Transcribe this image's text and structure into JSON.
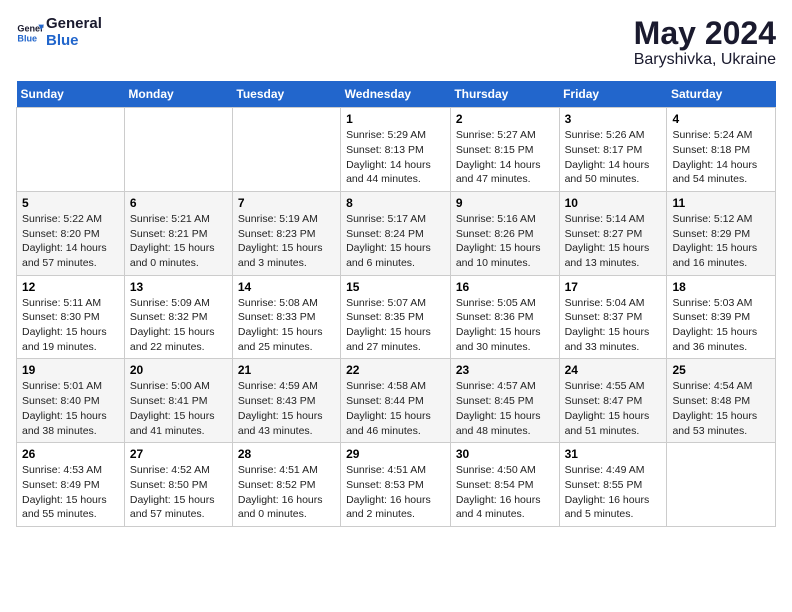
{
  "header": {
    "logo_line1": "General",
    "logo_line2": "Blue",
    "month_year": "May 2024",
    "location": "Baryshivka, Ukraine"
  },
  "days_of_week": [
    "Sunday",
    "Monday",
    "Tuesday",
    "Wednesday",
    "Thursday",
    "Friday",
    "Saturday"
  ],
  "weeks": [
    [
      {
        "day": "",
        "info": ""
      },
      {
        "day": "",
        "info": ""
      },
      {
        "day": "",
        "info": ""
      },
      {
        "day": "1",
        "info": "Sunrise: 5:29 AM\nSunset: 8:13 PM\nDaylight: 14 hours\nand 44 minutes."
      },
      {
        "day": "2",
        "info": "Sunrise: 5:27 AM\nSunset: 8:15 PM\nDaylight: 14 hours\nand 47 minutes."
      },
      {
        "day": "3",
        "info": "Sunrise: 5:26 AM\nSunset: 8:17 PM\nDaylight: 14 hours\nand 50 minutes."
      },
      {
        "day": "4",
        "info": "Sunrise: 5:24 AM\nSunset: 8:18 PM\nDaylight: 14 hours\nand 54 minutes."
      }
    ],
    [
      {
        "day": "5",
        "info": "Sunrise: 5:22 AM\nSunset: 8:20 PM\nDaylight: 14 hours\nand 57 minutes."
      },
      {
        "day": "6",
        "info": "Sunrise: 5:21 AM\nSunset: 8:21 PM\nDaylight: 15 hours\nand 0 minutes."
      },
      {
        "day": "7",
        "info": "Sunrise: 5:19 AM\nSunset: 8:23 PM\nDaylight: 15 hours\nand 3 minutes."
      },
      {
        "day": "8",
        "info": "Sunrise: 5:17 AM\nSunset: 8:24 PM\nDaylight: 15 hours\nand 6 minutes."
      },
      {
        "day": "9",
        "info": "Sunrise: 5:16 AM\nSunset: 8:26 PM\nDaylight: 15 hours\nand 10 minutes."
      },
      {
        "day": "10",
        "info": "Sunrise: 5:14 AM\nSunset: 8:27 PM\nDaylight: 15 hours\nand 13 minutes."
      },
      {
        "day": "11",
        "info": "Sunrise: 5:12 AM\nSunset: 8:29 PM\nDaylight: 15 hours\nand 16 minutes."
      }
    ],
    [
      {
        "day": "12",
        "info": "Sunrise: 5:11 AM\nSunset: 8:30 PM\nDaylight: 15 hours\nand 19 minutes."
      },
      {
        "day": "13",
        "info": "Sunrise: 5:09 AM\nSunset: 8:32 PM\nDaylight: 15 hours\nand 22 minutes."
      },
      {
        "day": "14",
        "info": "Sunrise: 5:08 AM\nSunset: 8:33 PM\nDaylight: 15 hours\nand 25 minutes."
      },
      {
        "day": "15",
        "info": "Sunrise: 5:07 AM\nSunset: 8:35 PM\nDaylight: 15 hours\nand 27 minutes."
      },
      {
        "day": "16",
        "info": "Sunrise: 5:05 AM\nSunset: 8:36 PM\nDaylight: 15 hours\nand 30 minutes."
      },
      {
        "day": "17",
        "info": "Sunrise: 5:04 AM\nSunset: 8:37 PM\nDaylight: 15 hours\nand 33 minutes."
      },
      {
        "day": "18",
        "info": "Sunrise: 5:03 AM\nSunset: 8:39 PM\nDaylight: 15 hours\nand 36 minutes."
      }
    ],
    [
      {
        "day": "19",
        "info": "Sunrise: 5:01 AM\nSunset: 8:40 PM\nDaylight: 15 hours\nand 38 minutes."
      },
      {
        "day": "20",
        "info": "Sunrise: 5:00 AM\nSunset: 8:41 PM\nDaylight: 15 hours\nand 41 minutes."
      },
      {
        "day": "21",
        "info": "Sunrise: 4:59 AM\nSunset: 8:43 PM\nDaylight: 15 hours\nand 43 minutes."
      },
      {
        "day": "22",
        "info": "Sunrise: 4:58 AM\nSunset: 8:44 PM\nDaylight: 15 hours\nand 46 minutes."
      },
      {
        "day": "23",
        "info": "Sunrise: 4:57 AM\nSunset: 8:45 PM\nDaylight: 15 hours\nand 48 minutes."
      },
      {
        "day": "24",
        "info": "Sunrise: 4:55 AM\nSunset: 8:47 PM\nDaylight: 15 hours\nand 51 minutes."
      },
      {
        "day": "25",
        "info": "Sunrise: 4:54 AM\nSunset: 8:48 PM\nDaylight: 15 hours\nand 53 minutes."
      }
    ],
    [
      {
        "day": "26",
        "info": "Sunrise: 4:53 AM\nSunset: 8:49 PM\nDaylight: 15 hours\nand 55 minutes."
      },
      {
        "day": "27",
        "info": "Sunrise: 4:52 AM\nSunset: 8:50 PM\nDaylight: 15 hours\nand 57 minutes."
      },
      {
        "day": "28",
        "info": "Sunrise: 4:51 AM\nSunset: 8:52 PM\nDaylight: 16 hours\nand 0 minutes."
      },
      {
        "day": "29",
        "info": "Sunrise: 4:51 AM\nSunset: 8:53 PM\nDaylight: 16 hours\nand 2 minutes."
      },
      {
        "day": "30",
        "info": "Sunrise: 4:50 AM\nSunset: 8:54 PM\nDaylight: 16 hours\nand 4 minutes."
      },
      {
        "day": "31",
        "info": "Sunrise: 4:49 AM\nSunset: 8:55 PM\nDaylight: 16 hours\nand 5 minutes."
      },
      {
        "day": "",
        "info": ""
      }
    ]
  ]
}
